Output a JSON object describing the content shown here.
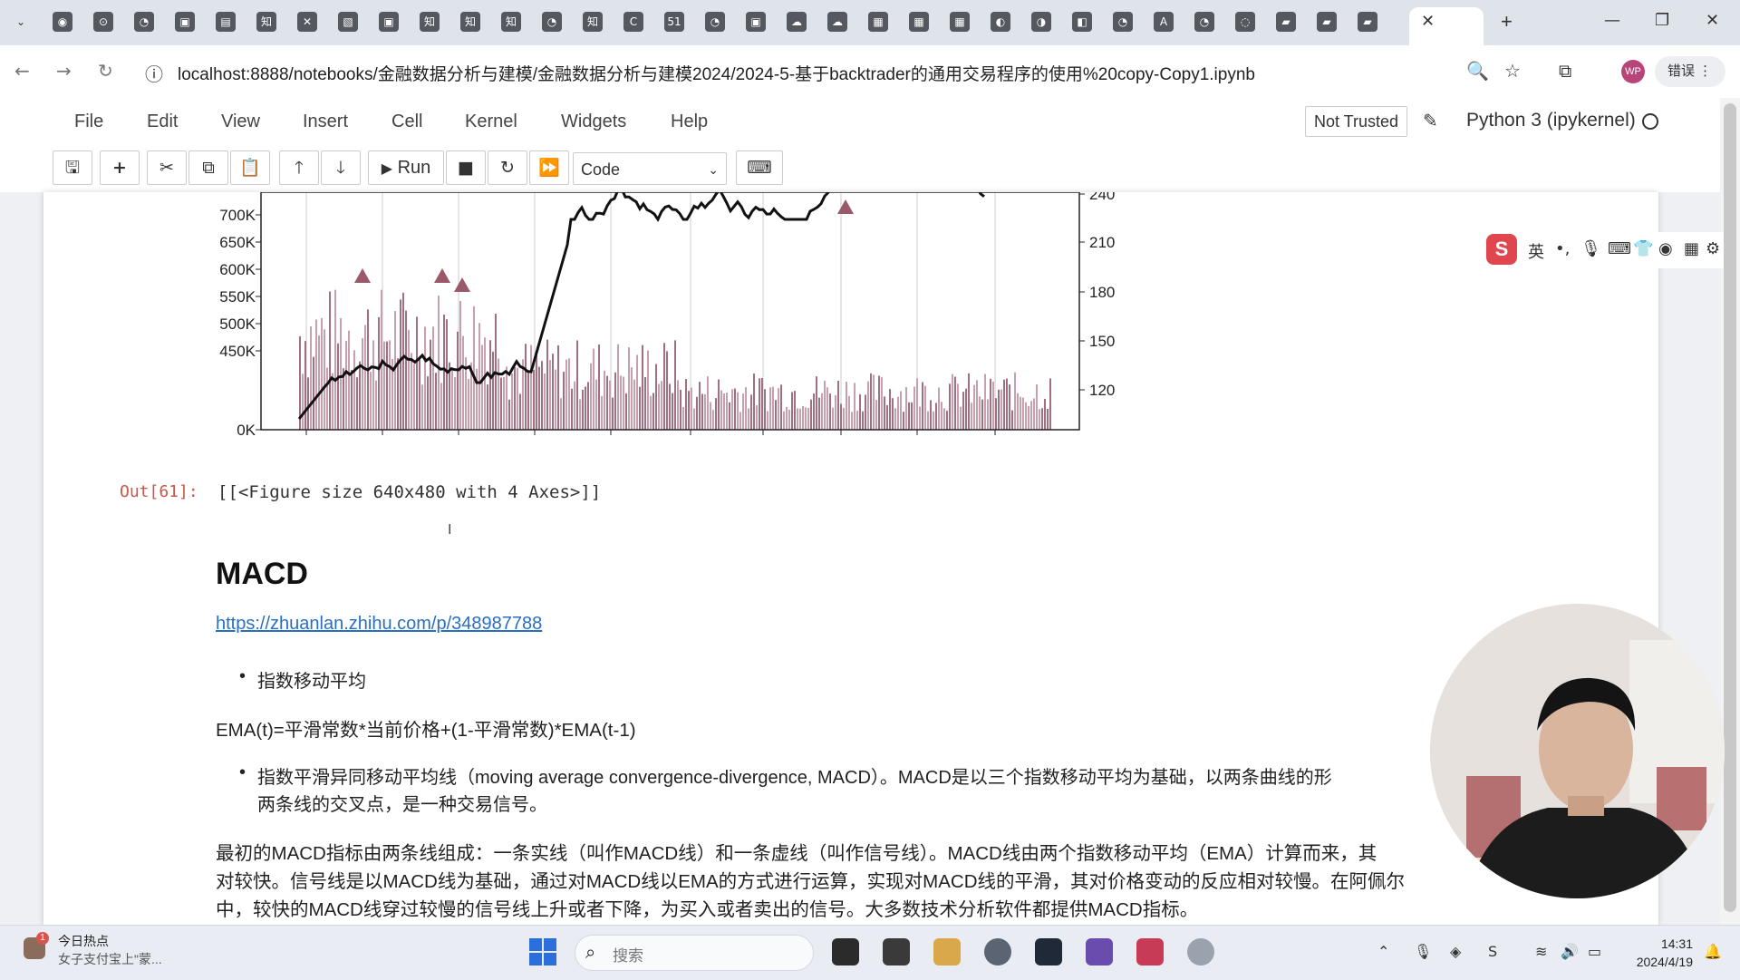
{
  "browser": {
    "tab_icons": [
      "◉",
      "⊙",
      "◔",
      "▣",
      "▤",
      "知",
      "✕",
      "▧",
      "▣",
      "知",
      "知",
      "知",
      "◔",
      "知",
      "C",
      "51",
      "◔",
      "▣",
      "☁",
      "☁",
      "▦",
      "▦",
      "▦",
      "◐",
      "◑",
      "◧",
      "◔",
      "A",
      "◔",
      "◌",
      "▰",
      "▰",
      "▰"
    ],
    "active_tab_close": "✕",
    "new_tab": "+",
    "url": "localhost:8888/notebooks/金融数据分析与建模/金融数据分析与建模2024/2024-5-基于backtrader的通用交易程序的使用%20copy-Copy1.ipynb",
    "profile": "WP",
    "error_button": "错误"
  },
  "jupyter": {
    "menu": [
      "File",
      "Edit",
      "View",
      "Insert",
      "Cell",
      "Kernel",
      "Widgets",
      "Help"
    ],
    "trust": "Not Trusted",
    "kernel": "Python 3 (ipykernel)",
    "run_label": "Run",
    "cell_type": "Code"
  },
  "chart_data": {
    "type": "bar",
    "description_axes": "volume bars with price line overlay",
    "left_tick_labels": [
      "700K",
      "650K",
      "600K",
      "550K",
      "500K",
      "450K",
      "0K"
    ],
    "right_tick_labels": [
      "240",
      "210",
      "180",
      "150",
      "120"
    ],
    "colors": {
      "bars": "#a07080",
      "line": "#111111",
      "markers": "#9a5a6a"
    }
  },
  "output": {
    "prompt": "Out[61]:",
    "text": "[[<Figure size 640x480 with 4 Axes>]]"
  },
  "markdown": {
    "heading": "MACD",
    "link": "https://zhuanlan.zhihu.com/p/348987788",
    "bullet1": "指数移动平均",
    "formula": "EMA(t)=平滑常数*当前价格+(1-平滑常数)*EMA(t-1)",
    "bullet2_line1": "指数平滑异同移动平均线（moving average convergence-divergence, MACD）。MACD是以三个指数移动平均为基础，以两条曲线的形",
    "bullet2_line2": "两条线的交叉点，是一种交易信号。",
    "para_line1": "最初的MACD指标由两条线组成：一条实线（叫作MACD线）和一条虚线（叫作信号线）。MACD线由两个指数移动平均（EMA）计算而来，其",
    "para_line2": "对较快。信号线是以MACD线为基础，通过对MACD线以EMA的方式进行运算，实现对MACD线的平滑，其对价格变动的反应相对较慢。在阿佩尔",
    "para_line3": "中，较快的MACD线穿过较慢的信号线上升或者下降，为买入或者卖出的信号。大多数技术分析软件都提供MACD指标。"
  },
  "ime": {
    "label": "英"
  },
  "taskbar": {
    "news_title": "今日热点",
    "news_sub": "女子支付宝上\"蒙...",
    "news_badge": "1",
    "search_placeholder": "搜索",
    "time": "14:31",
    "date": "2024/4/19"
  }
}
